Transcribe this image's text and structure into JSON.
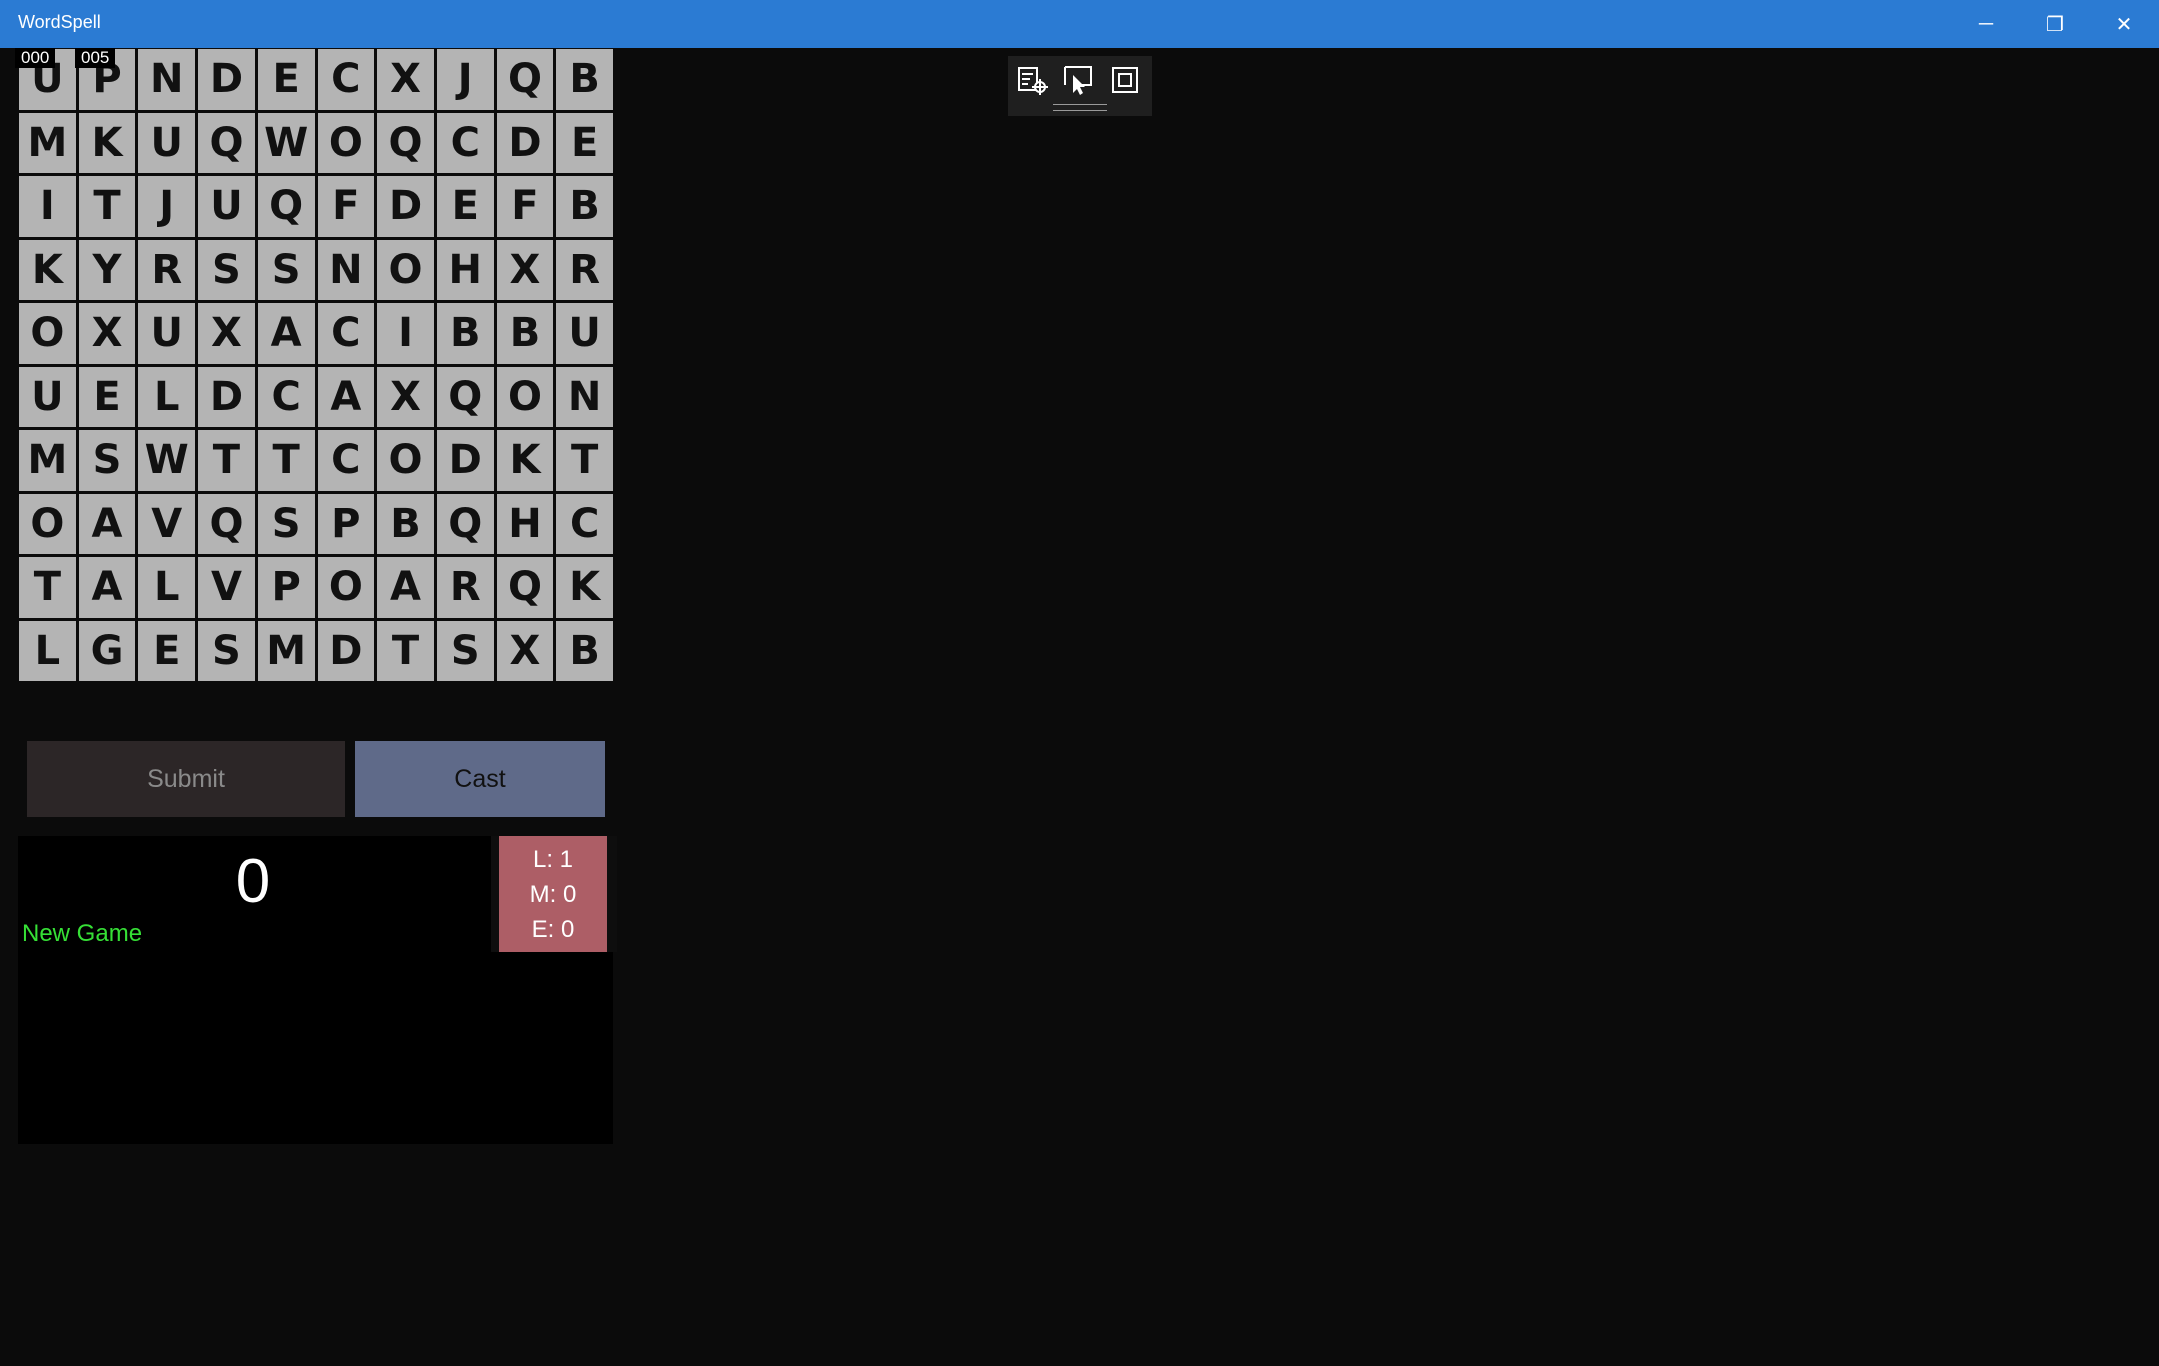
{
  "app": {
    "title": "WordSpell"
  },
  "window_controls": {
    "minimize": "─",
    "restore": "❐",
    "close": "✕"
  },
  "counters": {
    "left": "000",
    "right": "005"
  },
  "grid": {
    "rows": [
      [
        "U",
        "P",
        "N",
        "D",
        "E",
        "C",
        "X",
        "J",
        "Q",
        "B"
      ],
      [
        "M",
        "K",
        "U",
        "Q",
        "W",
        "O",
        "Q",
        "C",
        "D",
        "E"
      ],
      [
        "I",
        "T",
        "J",
        "U",
        "Q",
        "F",
        "D",
        "E",
        "F",
        "B"
      ],
      [
        "K",
        "Y",
        "R",
        "S",
        "S",
        "N",
        "O",
        "H",
        "X",
        "R"
      ],
      [
        "O",
        "X",
        "U",
        "X",
        "A",
        "C",
        "I",
        "B",
        "B",
        "U"
      ],
      [
        "U",
        "E",
        "L",
        "D",
        "C",
        "A",
        "X",
        "Q",
        "O",
        "N"
      ],
      [
        "M",
        "S",
        "W",
        "T",
        "T",
        "C",
        "O",
        "D",
        "K",
        "T"
      ],
      [
        "O",
        "A",
        "V",
        "Q",
        "S",
        "P",
        "B",
        "Q",
        "H",
        "C"
      ],
      [
        "T",
        "A",
        "L",
        "V",
        "P",
        "O",
        "A",
        "R",
        "Q",
        "K"
      ],
      [
        "L",
        "G",
        "E",
        "S",
        "M",
        "D",
        "T",
        "S",
        "X",
        "B"
      ]
    ]
  },
  "debug_toolbar": {
    "icons": [
      "live-visual-tree-icon",
      "select-element-icon",
      "display-layout-adorners-icon"
    ]
  },
  "actions": {
    "submit_label": "Submit",
    "cast_label": "Cast"
  },
  "score": {
    "value": "0",
    "new_game_label": "New Game"
  },
  "stats": {
    "l": "L: 1",
    "m": "M: 0",
    "e": "E: 0"
  },
  "colors": {
    "titlebar": "#2b7bd3",
    "tile": "#b4b4b4",
    "submit_bg": "#2c2627",
    "cast_bg": "#5f6a89",
    "stats_bg": "#ad5e66",
    "new_game": "#36e036"
  }
}
